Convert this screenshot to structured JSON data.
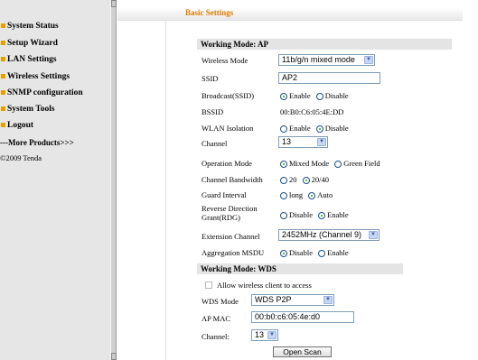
{
  "sidebar": {
    "items": [
      {
        "label": "System Status"
      },
      {
        "label": "Setup Wizard"
      },
      {
        "label": "LAN Settings"
      },
      {
        "label": "Wireless Settings"
      },
      {
        "label": "SNMP configuration"
      },
      {
        "label": "System Tools"
      },
      {
        "label": "Logout"
      }
    ],
    "more_products": "---More Products>>>",
    "copyright": "©2009 Tenda"
  },
  "header": {
    "title": "Basic Settings"
  },
  "ap": {
    "section_title": "Working Mode: AP",
    "wireless_mode": {
      "label": "Wireless Mode",
      "value": "11b/g/n mixed mode"
    },
    "ssid": {
      "label": "SSID",
      "value": "AP2"
    },
    "broadcast": {
      "label": "Broadcast(SSID)",
      "options": [
        "Enable",
        "Disable"
      ],
      "selected": "Enable"
    },
    "bssid": {
      "label": "BSSID",
      "value": "00:B0:C6:05:4E:DD"
    },
    "wlan_isolation": {
      "label": "WLAN Isolation",
      "options": [
        "Enable",
        "Disable"
      ],
      "selected": "Disable"
    },
    "channel": {
      "label": "Channel",
      "value": "13"
    },
    "operation_mode": {
      "label": "Operation Mode",
      "options": [
        "Mixed Mode",
        "Green Field"
      ],
      "selected": "Mixed Mode"
    },
    "channel_bandwidth": {
      "label": "Channel Bandwidth",
      "options": [
        "20",
        "20/40"
      ],
      "selected": "20/40"
    },
    "guard_interval": {
      "label": "Guard Interval",
      "options": [
        "long",
        "Auto"
      ],
      "selected": "Auto"
    },
    "rdg": {
      "label_line1": "Reverse Direction",
      "label_line2": "Grant(RDG)",
      "options": [
        "Disable",
        "Enable"
      ],
      "selected": "Enable"
    },
    "extension_channel": {
      "label": "Extension Channel",
      "value": "2452MHz (Channel 9)"
    },
    "aggregation_msdu": {
      "label": "Aggregation MSDU",
      "options": [
        "Disable",
        "Enable"
      ],
      "selected": "Disable"
    }
  },
  "wds": {
    "section_title": "Working Mode: WDS",
    "allow_client": {
      "label": "Allow wireless client to access",
      "checked": false
    },
    "wds_mode": {
      "label": "WDS Mode",
      "value": "WDS P2P"
    },
    "ap_mac": {
      "label": "AP MAC",
      "value": "00:b0:c6:05:4e:d0"
    },
    "channel": {
      "label": "Channel:",
      "value": "13"
    },
    "open_scan_label": "Open Scan"
  },
  "colors": {
    "accent": "#e8a000",
    "title": "#e07b00",
    "sidebar_bg": "#e6e6e6"
  }
}
